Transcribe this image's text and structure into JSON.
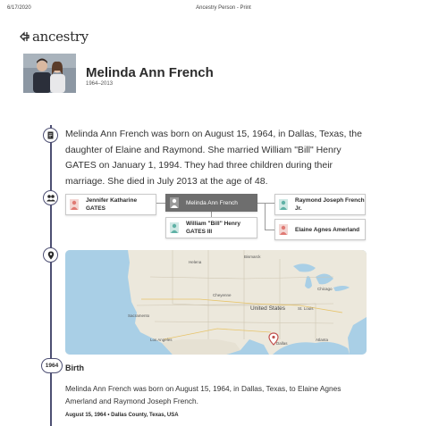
{
  "print_header": {
    "date": "6/17/2020",
    "title": "Ancestry Person - Print"
  },
  "brand": {
    "logo_text": "ancestry",
    "accent": "#4d4f73"
  },
  "person": {
    "name": "Melinda Ann French",
    "years": "1964–2013"
  },
  "biography": "Melinda Ann French was born on August 15, 1964, in Dallas, Texas, the daughter of Elaine and Raymond. She married William \"Bill\" Henry GATES on January 1, 1994. They had three children during their marriage. She died in July 2013 at the age of 48.",
  "family": {
    "child": {
      "name": "Jennifer Katharine GATES",
      "sex": "female"
    },
    "self": {
      "name": "Melinda Ann French",
      "sex": "female"
    },
    "spouse": {
      "name": "William \"Bill\" Henry GATES III",
      "sex": "male"
    },
    "father": {
      "name": "Raymond Joseph French Jr.",
      "sex": "male"
    },
    "mother": {
      "name": "Elaine Agnes Amerland",
      "sex": "female"
    }
  },
  "map": {
    "labels": {
      "helena": "Helena",
      "bismarck": "Bismarck",
      "cheyenne": "Cheyenne",
      "sacramento": "Sacramento",
      "los_angeles": "Los Angeles",
      "chicago": "Chicago",
      "united_states": "United States",
      "st_louis": "St. Louis",
      "atlanta": "Atlanta",
      "dallas": "Dallas"
    },
    "pin_color": "#c0504d"
  },
  "timeline": {
    "event_year": "1964"
  },
  "event": {
    "title": "Birth",
    "description": "Melinda Ann French was born on August 15, 1964, in Dallas, Texas, to Elaine Agnes Amerland and Raymond Joseph French.",
    "date": "August 15, 1964",
    "separator": " • ",
    "place": "Dallas County, Texas, USA"
  },
  "colors": {
    "female": "#e07a74",
    "male": "#5fb1a6"
  }
}
